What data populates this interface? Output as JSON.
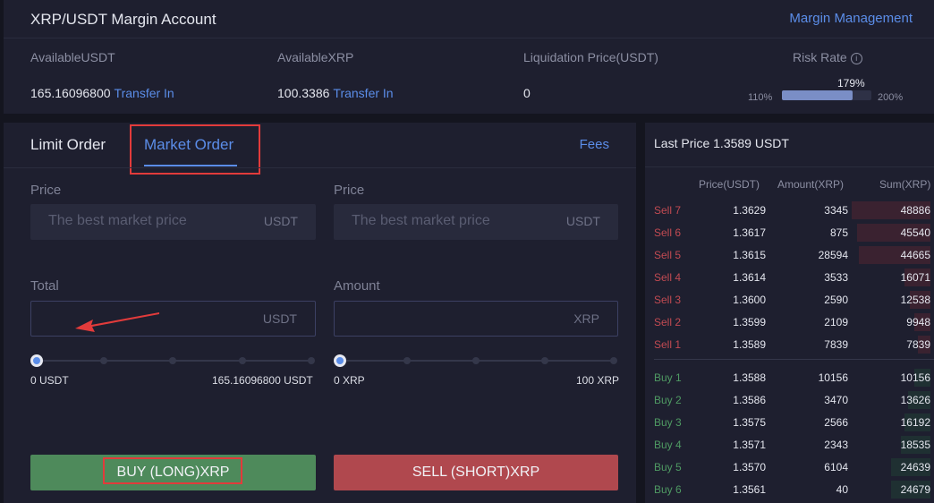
{
  "account": {
    "title": "XRP/USDT Margin Account",
    "management_link": "Margin Management",
    "available_usdt_label": "AvailableUSDT",
    "available_usdt_value": "165.16096800",
    "available_xrp_label": "AvailableXRP",
    "available_xrp_value": "100.3386",
    "transfer_in": "Transfer In",
    "liquidation_label": "Liquidation Price(USDT)",
    "liquidation_value": "0",
    "risk_label": "Risk Rate",
    "risk_info_icon": "i",
    "risk_percent": "179%",
    "risk_fraction": 0.79,
    "risk_min": "110%",
    "risk_max": "200%"
  },
  "order": {
    "tabs": {
      "limit": "Limit Order",
      "market": "Market Order"
    },
    "fees": "Fees",
    "buy": {
      "price_label": "Price",
      "price_placeholder": "The best market price",
      "price_unit": "USDT",
      "total_label": "Total",
      "total_unit": "USDT",
      "slider_min": "0 USDT",
      "slider_max": "165.16096800 USDT",
      "slider_value": 0,
      "button": "BUY (LONG)XRP"
    },
    "sell": {
      "price_label": "Price",
      "price_placeholder": "The best market price",
      "price_unit": "USDT",
      "amount_label": "Amount",
      "amount_unit": "XRP",
      "slider_min": "0 XRP",
      "slider_max": "100 XRP",
      "slider_value": 0,
      "button": "SELL (SHORT)XRP"
    }
  },
  "book": {
    "last_price": "Last Price 1.3589 USDT",
    "headers": {
      "price": "Price(USDT)",
      "amount": "Amount(XRP)",
      "sum": "Sum(XRP)"
    },
    "max_sum": 48886,
    "sells": [
      {
        "label": "Sell 7",
        "price": "1.3629",
        "amount": "3345",
        "sum": "48886",
        "depth": 48886
      },
      {
        "label": "Sell 6",
        "price": "1.3617",
        "amount": "875",
        "sum": "45540",
        "depth": 45540
      },
      {
        "label": "Sell 5",
        "price": "1.3615",
        "amount": "28594",
        "sum": "44665",
        "depth": 44665
      },
      {
        "label": "Sell 4",
        "price": "1.3614",
        "amount": "3533",
        "sum": "16071",
        "depth": 16071
      },
      {
        "label": "Sell 3",
        "price": "1.3600",
        "amount": "2590",
        "sum": "12538",
        "depth": 12538
      },
      {
        "label": "Sell 2",
        "price": "1.3599",
        "amount": "2109",
        "sum": "9948",
        "depth": 9948
      },
      {
        "label": "Sell 1",
        "price": "1.3589",
        "amount": "7839",
        "sum": "7839",
        "depth": 7839
      }
    ],
    "buys": [
      {
        "label": "Buy 1",
        "price": "1.3588",
        "amount": "10156",
        "sum": "10156",
        "depth": 10156
      },
      {
        "label": "Buy 2",
        "price": "1.3586",
        "amount": "3470",
        "sum": "13626",
        "depth": 13626
      },
      {
        "label": "Buy 3",
        "price": "1.3575",
        "amount": "2566",
        "sum": "16192",
        "depth": 16192
      },
      {
        "label": "Buy 4",
        "price": "1.3571",
        "amount": "2343",
        "sum": "18535",
        "depth": 18535
      },
      {
        "label": "Buy 5",
        "price": "1.3570",
        "amount": "6104",
        "sum": "24639",
        "depth": 24639
      },
      {
        "label": "Buy 6",
        "price": "1.3561",
        "amount": "40",
        "sum": "24679",
        "depth": 24679
      }
    ]
  },
  "colors": {
    "accent": "#5b8de8",
    "buy": "#4e8a5b",
    "sell": "#b0484e",
    "highlight": "#e23b3b"
  }
}
